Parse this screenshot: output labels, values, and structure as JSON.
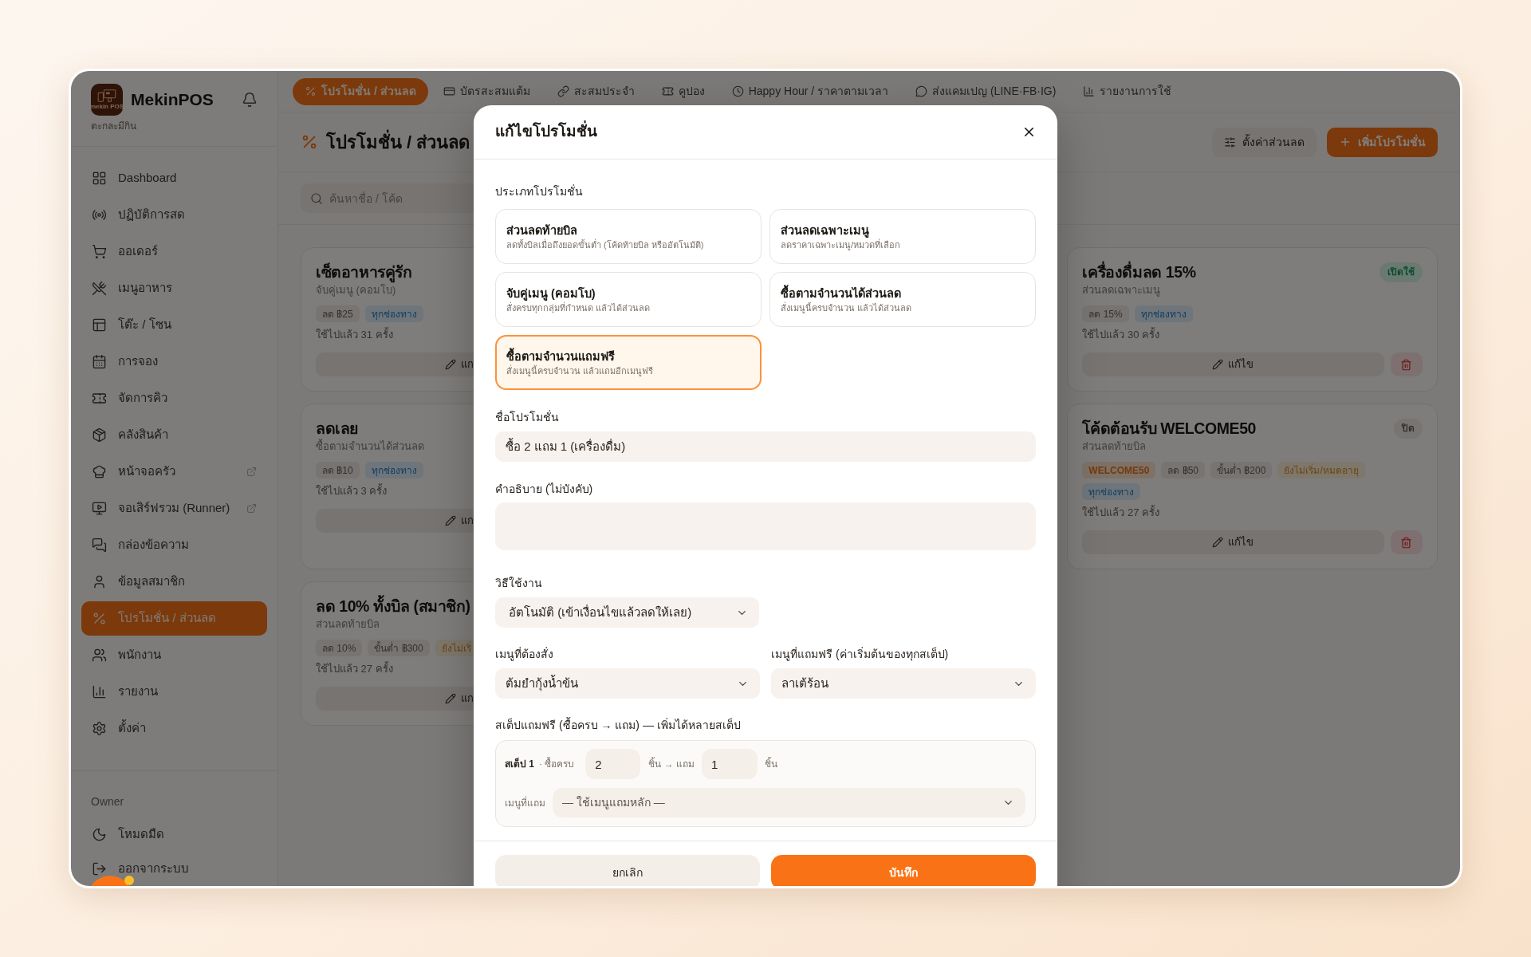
{
  "sidebar": {
    "logo_text": "mekin POS",
    "brand": "MekinPOS",
    "store": "ตะกละมีกิน",
    "items": [
      {
        "label": "Dashboard",
        "selected": false,
        "external": false
      },
      {
        "label": "ปฏิบัติการสด",
        "selected": false,
        "external": false
      },
      {
        "label": "ออเดอร์",
        "selected": false,
        "external": false
      },
      {
        "label": "เมนูอาหาร",
        "selected": false,
        "external": false
      },
      {
        "label": "โต๊ะ / โซน",
        "selected": false,
        "external": false
      },
      {
        "label": "การจอง",
        "selected": false,
        "external": false
      },
      {
        "label": "จัดการคิว",
        "selected": false,
        "external": false
      },
      {
        "label": "คลังสินค้า",
        "selected": false,
        "external": false
      },
      {
        "label": "หน้าจอครัว",
        "selected": false,
        "external": true
      },
      {
        "label": "จอเสิร์ฟรวม (Runner)",
        "selected": false,
        "external": true
      },
      {
        "label": "กล่องข้อความ",
        "selected": false,
        "external": false
      },
      {
        "label": "ข้อมูลสมาชิก",
        "selected": false,
        "external": false
      },
      {
        "label": "โปรโมชั่น / ส่วนลด",
        "selected": true,
        "external": false
      },
      {
        "label": "พนักงาน",
        "selected": false,
        "external": false
      },
      {
        "label": "รายงาน",
        "selected": false,
        "external": false
      },
      {
        "label": "ตั้งค่า",
        "selected": false,
        "external": false
      }
    ],
    "role": "Owner",
    "footer_items": [
      {
        "label": "โหมดมืด"
      },
      {
        "label": "ออกจากระบบ"
      }
    ]
  },
  "top_tabs": [
    {
      "label": "โปรโมชั่น / ส่วนลด",
      "selected": true
    },
    {
      "label": "บัตรสะสมแต้ม",
      "selected": false
    },
    {
      "label": "สะสมประจำ",
      "selected": false
    },
    {
      "label": "คูปอง",
      "selected": false
    },
    {
      "label": "Happy Hour / ราคาตามเวลา",
      "selected": false
    },
    {
      "label": "ส่งแคมเปญ (LINE·FB·IG)",
      "selected": false
    },
    {
      "label": "รายงานการใช้",
      "selected": false
    }
  ],
  "page_header": {
    "title": "โปรโมชั่น / ส่วนลด",
    "buttons": [
      {
        "label": "ตั้งค่าส่วนลด",
        "kind": "secondary"
      },
      {
        "label": "เพิ่มโปรโมชั่น",
        "kind": "primary"
      }
    ]
  },
  "search": {
    "placeholder": "ค้นหาชื่อ / โค้ด"
  },
  "card_rows": [
    {
      "cards": [
        {
          "title": "เซ็ตอาหารคู่รัก",
          "type": "จับคู่เมนู (คอมโบ)",
          "tags": [
            {
              "label": "ลด ฿25",
              "kind": "plain"
            },
            {
              "label": "ทุกช่องทาง",
              "kind": "channel"
            }
          ],
          "usage": "ใช้ไปแล้ว 31 ครั้ง",
          "edit": "แก"
        },
        {
          "title": "เครื่องดื่มลด 15%",
          "type": "ส่วนลดเฉพาะเมนู",
          "status": {
            "label": "เปิดใช้",
            "on": true
          },
          "tags": [
            {
              "label": "ลด 15%",
              "kind": "plain"
            },
            {
              "label": "ทุกช่องทาง",
              "kind": "channel"
            }
          ],
          "usage": "ใช้ไปแล้ว 30 ครั้ง",
          "edit": "แก้ไข",
          "delete_button": true
        }
      ]
    },
    {
      "cards": [
        {
          "title": "ลดเลย",
          "type": "ซื้อตามจำนวนได้ส่วนลด",
          "tags": [
            {
              "label": "ลด ฿10",
              "kind": "plain"
            },
            {
              "label": "ทุกช่องทาง",
              "kind": "channel"
            }
          ],
          "usage": "ใช้ไปแล้ว 3 ครั้ง",
          "edit": "แก"
        },
        {
          "title": "โค้ดต้อนรับ WELCOME50",
          "type": "ส่วนลดท้ายบิล",
          "status": {
            "label": "ปิด",
            "on": false
          },
          "tags": [
            {
              "label": "WELCOME50",
              "kind": "code"
            },
            {
              "label": "ลด ฿50",
              "kind": "plain"
            },
            {
              "label": "ขั้นต่ำ ฿200",
              "kind": "plain"
            },
            {
              "label": "ยังไม่เริ่ม/หมดอายุ",
              "kind": "warning"
            },
            {
              "label": "ทุกช่องทาง",
              "kind": "channel"
            }
          ],
          "usage": "ใช้ไปแล้ว 27 ครั้ง",
          "edit": "แก้ไข",
          "delete_button": true
        }
      ]
    },
    {
      "cards": [
        {
          "title": "ลด 10% ทั้งบิล (สมาชิก)",
          "type": "ส่วนลดท้ายบิล",
          "tags": [
            {
              "label": "ลด 10%",
              "kind": "plain"
            },
            {
              "label": "ขั้นต่ำ ฿300",
              "kind": "plain"
            },
            {
              "label": "ยังไม่เริ่",
              "kind": "warning"
            }
          ],
          "usage": "ใช้ไปแล้ว 27 ครั้ง",
          "edit": "แก"
        }
      ]
    }
  ],
  "dialog": {
    "title": "แก้ไขโปรโมชั่น",
    "type_label": "ประเภทโปรโมชั่น",
    "types": [
      {
        "title": "ส่วนลดท้ายบิล",
        "description": "ลดทั้งบิลเมื่อถึงยอดขั้นต่ำ (โค้ดท้ายบิล หรืออัตโนมัติ)",
        "selected": false
      },
      {
        "title": "ส่วนลดเฉพาะเมนู",
        "description": "ลดราคาเฉพาะเมนู/หมวดที่เลือก",
        "selected": false
      },
      {
        "title": "จับคู่เมนู (คอมโบ)",
        "description": "สั่งครบทุกกลุ่มที่กำหนด แล้วได้ส่วนลด",
        "selected": false
      },
      {
        "title": "ซื้อตามจำนวนได้ส่วนลด",
        "description": "สั่งเมนูนี้ครบจำนวน แล้วได้ส่วนลด",
        "selected": false
      },
      {
        "title": "ซื้อตามจำนวนแถมฟรี",
        "description": "สั่งเมนูนี้ครบจำนวน แล้วแถมอีกเมนูฟรี",
        "selected": true
      }
    ],
    "name": {
      "label": "ชื่อโปรโมชั่น",
      "value": "ซื้อ 2 แถม 1 (เครื่องดื่ม)"
    },
    "description": {
      "label": "คำอธิบาย (ไม่บังคับ)"
    },
    "mode": {
      "label": "วิธีใช้งาน",
      "value": "อัตโนมัติ (เข้าเงื่อนไขแล้วลดให้เลย)"
    },
    "required_menu": {
      "label": "เมนูที่ต้องสั่ง",
      "value": "ต้มยำกุ้งน้ำข้น"
    },
    "free_menu": {
      "label": "เมนูที่แถมฟรี (ค่าเริ่มต้นของทุกสเต็ป)",
      "value": "ลาเต้ร้อน"
    },
    "steps_label": "สเต็ปแถมฟรี (ซื้อครบ → แถม) — เพิ่มได้หลายสเต็ป",
    "steps": [
      {
        "title": "สเต็ป 1",
        "buy_label": "· ซื้อครบ",
        "buy": "2",
        "get_label": "ชิ้น → แถม",
        "get": "1",
        "unit": "ชิ้น",
        "menu_label": "เมนูที่แถม",
        "menu": "— ใช้เมนูแถมหลัก —"
      }
    ],
    "buttons": [
      {
        "label": "ยกเลิก",
        "kind": "secondary"
      },
      {
        "label": "บันทึก",
        "kind": "primary"
      }
    ]
  }
}
